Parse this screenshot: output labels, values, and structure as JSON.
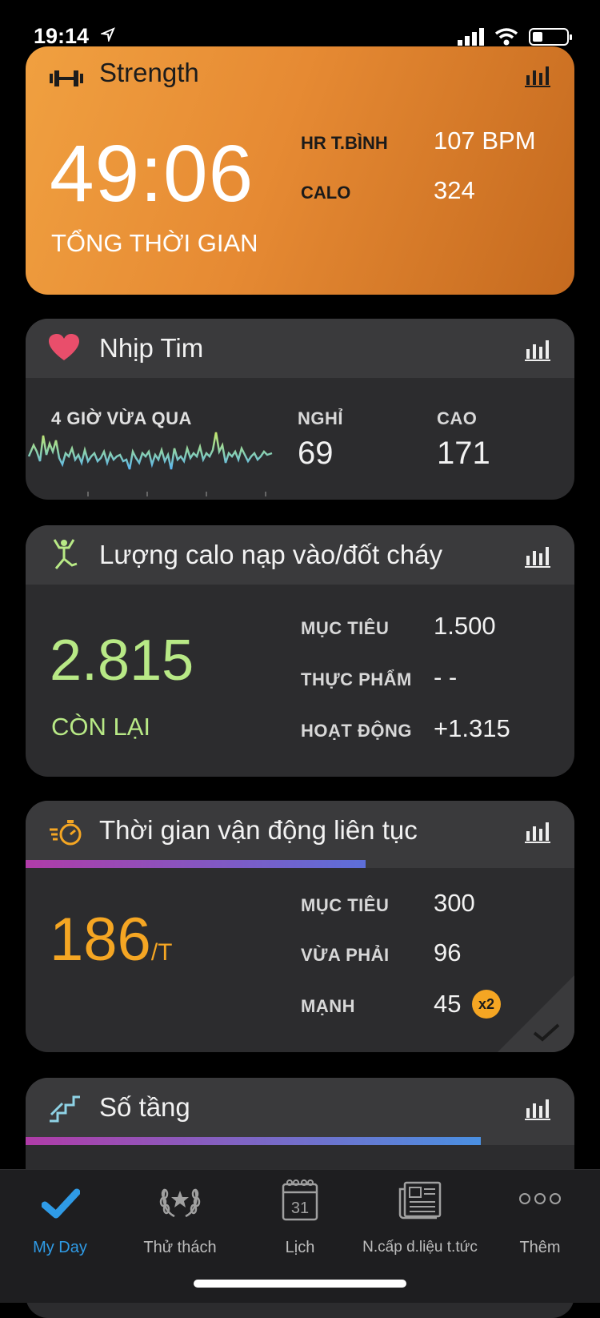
{
  "status_bar": {
    "time": "19:14"
  },
  "strength": {
    "title": "Strength",
    "total_time": "49:06",
    "total_time_label": "TỔNG THỜI GIAN",
    "hr_avg_label": "HR T.BÌNH",
    "hr_avg_value": "107 BPM",
    "calories_label": "CALO",
    "calories_value": "324"
  },
  "heart_rate": {
    "title": "Nhịp Tim",
    "period_label": "4 GIỜ VỪA QUA",
    "resting_label": "NGHỈ",
    "resting_value": "69",
    "high_label": "CAO",
    "high_value": "171"
  },
  "calories": {
    "title": "Lượng calo nạp vào/đốt cháy",
    "remaining_value": "2.815",
    "remaining_label": "CÒN LẠI",
    "goal_label": "MỤC TIÊU",
    "goal_value": "1.500",
    "food_label": "THỰC PHẨM",
    "food_value": "- -",
    "activity_label": "HOẠT ĐỘNG",
    "activity_value": "+1.315"
  },
  "intensity": {
    "title": "Thời gian vận động liên tục",
    "total_value": "186",
    "total_unit": "/T",
    "progress": 0.62,
    "goal_label": "MỤC TIÊU",
    "goal_value": "300",
    "moderate_label": "VỪA PHẢI",
    "moderate_value": "96",
    "vigorous_label": "MẠNH",
    "vigorous_value": "45",
    "vigorous_badge": "x2"
  },
  "floors": {
    "title": "Số tầng",
    "progress": 0.83
  },
  "tab_bar": {
    "tabs": [
      {
        "label": "My Day",
        "icon": "checkmark-icon",
        "active": true
      },
      {
        "label": "Thử thách",
        "icon": "laurel-icon",
        "active": false
      },
      {
        "label": "Lịch",
        "icon": "calendar-icon",
        "calendar_day": "31",
        "active": false
      },
      {
        "label": "N.cấp d.liệu t.tức",
        "icon": "news-icon",
        "active": false
      },
      {
        "label": "Thêm",
        "icon": "more-icon",
        "active": false
      }
    ]
  },
  "colors": {
    "accent_blue": "#2f9be6",
    "strength_orange": "#e68a33",
    "calorie_green": "#b8e986",
    "intensity_orange": "#f5a623",
    "heart_pink": "#e94e6b"
  }
}
